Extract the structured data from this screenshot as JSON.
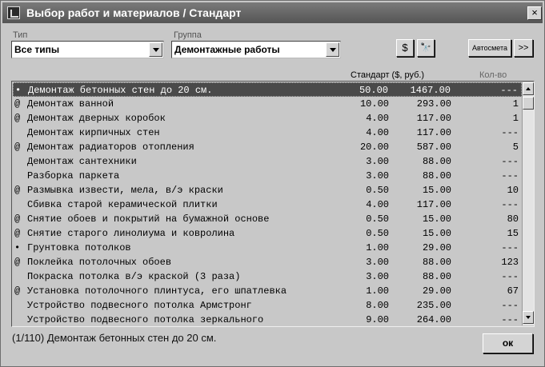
{
  "window": {
    "title": "Выбор работ и материалов / Стандарт",
    "close_glyph": "×"
  },
  "filters": {
    "type_label": "Тип",
    "type_value": "Все типы",
    "group_label": "Группа",
    "group_value": "Демонтажные работы"
  },
  "toolbar": {
    "dollar_label": "$",
    "binoculars_glyph": "🔭",
    "autosmeta_label": "Автосмета",
    "next_label": ">>"
  },
  "columns": {
    "standard": "Стандарт ($, руб.)",
    "qty": "Кол-во"
  },
  "rows": [
    {
      "mark": "•",
      "name": "Демонтаж бетонных стен до 20 см.",
      "base": "50.00",
      "price": "1467.00",
      "qty": "---"
    },
    {
      "mark": "@",
      "name": "Демонтаж ванной",
      "base": "10.00",
      "price": "293.00",
      "qty": "1"
    },
    {
      "mark": "@",
      "name": "Демонтаж дверных коробок",
      "base": "4.00",
      "price": "117.00",
      "qty": "1"
    },
    {
      "mark": "",
      "name": "Демонтаж кирпичных стен",
      "base": "4.00",
      "price": "117.00",
      "qty": "---"
    },
    {
      "mark": "@",
      "name": "Демонтаж радиаторов отопления",
      "base": "20.00",
      "price": "587.00",
      "qty": "5"
    },
    {
      "mark": "",
      "name": "Демонтаж сантехники",
      "base": "3.00",
      "price": "88.00",
      "qty": "---"
    },
    {
      "mark": "",
      "name": "Разборка паркета",
      "base": "3.00",
      "price": "88.00",
      "qty": "---"
    },
    {
      "mark": "@",
      "name": "Размывка извести, мела, в/э краски",
      "base": "0.50",
      "price": "15.00",
      "qty": "10"
    },
    {
      "mark": "",
      "name": "Сбивка старой керамической плитки",
      "base": "4.00",
      "price": "117.00",
      "qty": "---"
    },
    {
      "mark": "@",
      "name": "Снятие обоев и покрытий на бумажной основе",
      "base": "0.50",
      "price": "15.00",
      "qty": "80"
    },
    {
      "mark": "@",
      "name": "Снятие старого линолиума и ковролина",
      "base": "0.50",
      "price": "15.00",
      "qty": "15"
    },
    {
      "mark": "•",
      "name": "Грунтовка потолков",
      "base": "1.00",
      "price": "29.00",
      "qty": "---"
    },
    {
      "mark": "@",
      "name": "Поклейка потолочных обоев",
      "base": "3.00",
      "price": "88.00",
      "qty": "123"
    },
    {
      "mark": "",
      "name": "Покраска потолка в/э краской (3 раза)",
      "base": "3.00",
      "price": "88.00",
      "qty": "---"
    },
    {
      "mark": "@",
      "name": "Установка потолочного плинтуса, его шпатлевка",
      "base": "1.00",
      "price": "29.00",
      "qty": "67"
    },
    {
      "mark": "",
      "name": "Устройство подвесного потолка Армстронг",
      "base": "8.00",
      "price": "235.00",
      "qty": "---"
    },
    {
      "mark": "",
      "name": "Устройство подвесного потолка зеркального",
      "base": "9.00",
      "price": "264.00",
      "qty": "---"
    }
  ],
  "status": {
    "text": "(1/110)  Демонтаж бетонных стен до 20 см."
  },
  "ok_label": "ок"
}
